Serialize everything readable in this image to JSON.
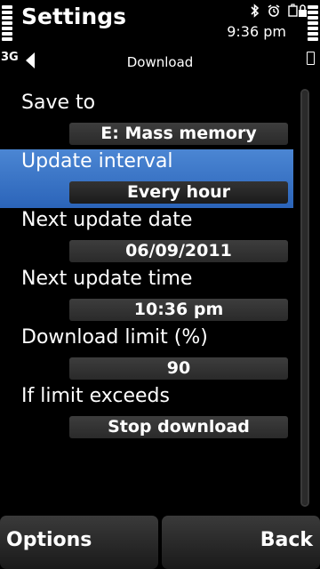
{
  "status_bar": {
    "app_title": "Settings",
    "time": "9:36 pm",
    "icons": [
      "bluetooth-icon",
      "alarm-icon",
      "sim-lock-icon"
    ]
  },
  "navi": {
    "network": "3G",
    "title": "Download"
  },
  "settings": [
    {
      "label": "Save to",
      "value": "E: Mass memory",
      "selected": false
    },
    {
      "label": "Update interval",
      "value": "Every hour",
      "selected": true
    },
    {
      "label": "Next update date",
      "value": "06/09/2011",
      "selected": false
    },
    {
      "label": "Next update time",
      "value": "10:36 pm",
      "selected": false
    },
    {
      "label": "Download limit (%)",
      "value": "90",
      "selected": false
    },
    {
      "label": "If limit exceeds",
      "value": "Stop download",
      "selected": false
    }
  ],
  "softkeys": {
    "left": "Options",
    "right": "Back"
  },
  "colors": {
    "selection": "#3a76c8",
    "background": "#000000",
    "value_box": "#333333"
  }
}
